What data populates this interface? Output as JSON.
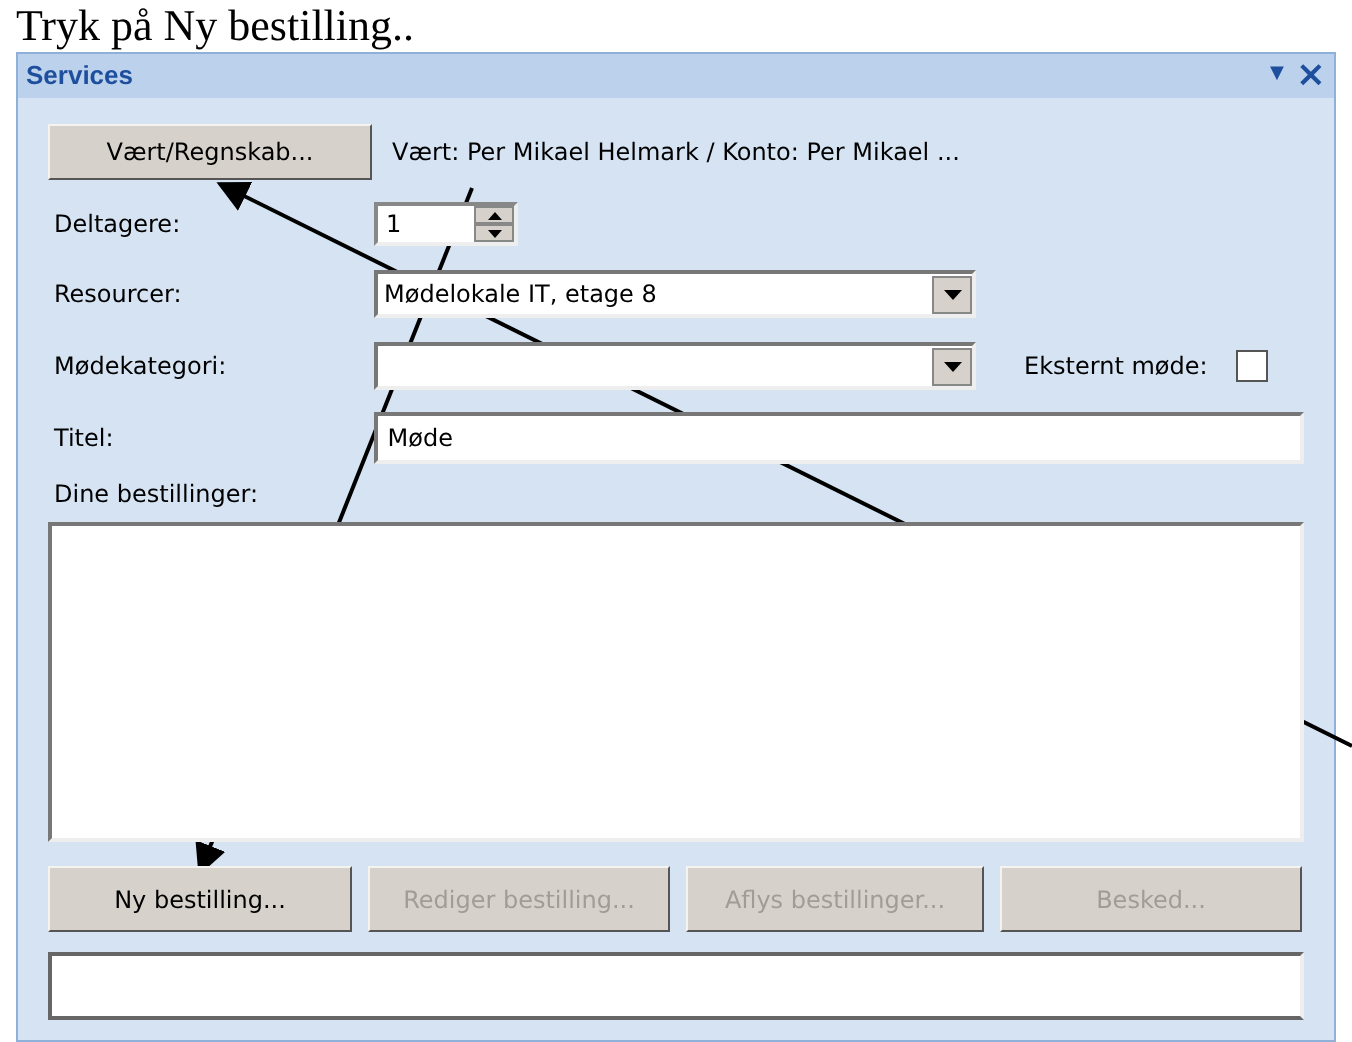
{
  "caption": "Tryk på Ny bestilling..",
  "panel": {
    "title": "Services",
    "menu_glyph": "▼",
    "close_glyph": "×"
  },
  "host_button": {
    "label": "Vært/Regnskab..."
  },
  "host_text": "Vært: Per Mikael Helmark / Konto:  Per Mikael ...",
  "participants": {
    "label": "Deltagere:",
    "value": "1"
  },
  "resources": {
    "label": "Resourcer:",
    "value": "Mødelokale IT, etage 8"
  },
  "category": {
    "label": "Mødekategori:"
  },
  "external": {
    "label": "Eksternt møde:",
    "checked": false
  },
  "title_field": {
    "label": "Titel:",
    "value": "Møde"
  },
  "orders": {
    "label": "Dine bestillinger:"
  },
  "buttons": [
    {
      "label": "Ny bestilling...",
      "disabled": false
    },
    {
      "label": "Rediger bestilling...",
      "disabled": true
    },
    {
      "label": "Aflys bestillinger...",
      "disabled": true
    },
    {
      "label": "Besked...",
      "disabled": true
    }
  ]
}
